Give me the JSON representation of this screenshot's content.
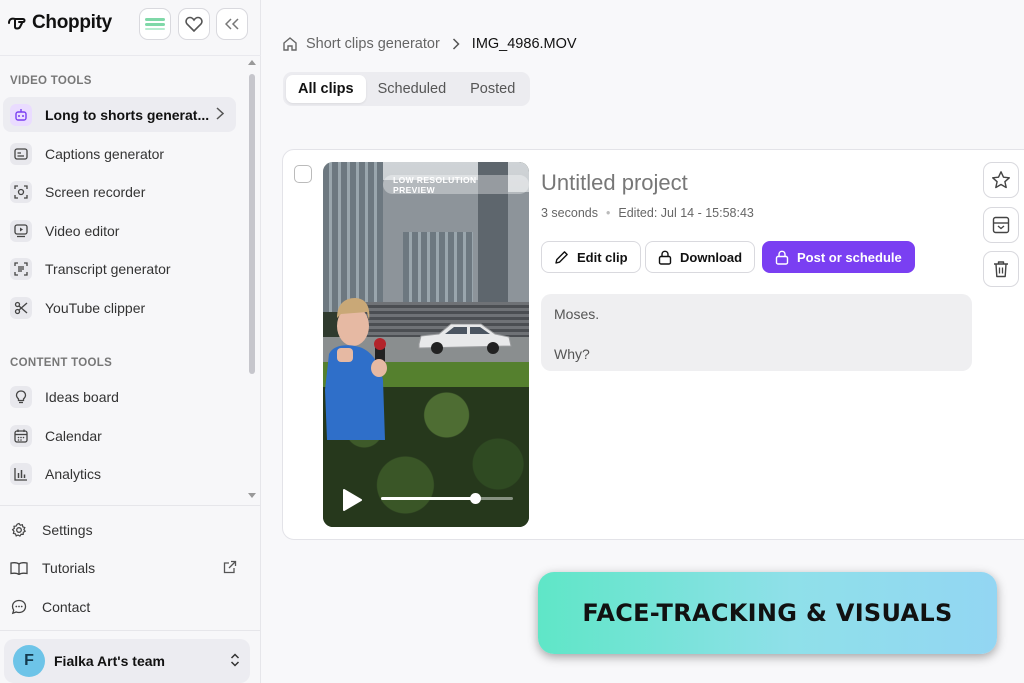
{
  "app": {
    "name": "Choppity"
  },
  "sidebar": {
    "video_tools_label": "VIDEO TOOLS",
    "content_tools_label": "CONTENT TOOLS",
    "video_tools": [
      {
        "label": "Long to shorts generat...",
        "icon": "robot-icon"
      },
      {
        "label": "Captions generator",
        "icon": "captions-icon"
      },
      {
        "label": "Screen recorder",
        "icon": "screen-record-icon"
      },
      {
        "label": "Video editor",
        "icon": "video-editor-icon"
      },
      {
        "label": "Transcript generator",
        "icon": "transcript-icon"
      },
      {
        "label": "YouTube clipper",
        "icon": "scissors-icon"
      }
    ],
    "content_tools": [
      {
        "label": "Ideas board",
        "icon": "lightbulb-icon"
      },
      {
        "label": "Calendar",
        "icon": "calendar-icon"
      },
      {
        "label": "Analytics",
        "icon": "analytics-icon"
      }
    ],
    "footer": [
      {
        "label": "Settings",
        "icon": "gear-icon"
      },
      {
        "label": "Tutorials",
        "icon": "book-icon"
      },
      {
        "label": "Contact",
        "icon": "chat-icon"
      }
    ],
    "team": {
      "initial": "F",
      "name": "Fialka Art's team"
    }
  },
  "breadcrumb": {
    "parent": "Short clips generator",
    "current": "IMG_4986.MOV"
  },
  "tabs": [
    {
      "label": "All clips",
      "active": true
    },
    {
      "label": "Scheduled",
      "active": false
    },
    {
      "label": "Posted",
      "active": false
    }
  ],
  "clip": {
    "title": "Untitled project",
    "duration": "3 seconds",
    "edited": "Edited: Jul 14 - 15:58:43",
    "watermark": "LOW RESOLUTION PREVIEW",
    "progress": 0.71,
    "buttons": {
      "edit": "Edit clip",
      "download": "Download",
      "post": "Post or schedule"
    },
    "transcript": [
      "Moses.",
      "Why?"
    ]
  },
  "banner": {
    "text": "FACE-TRACKING & VISUALS"
  },
  "colors": {
    "accent": "#7a3ff2",
    "banner_start": "#5fe6c7",
    "banner_end": "#93d6f3"
  }
}
